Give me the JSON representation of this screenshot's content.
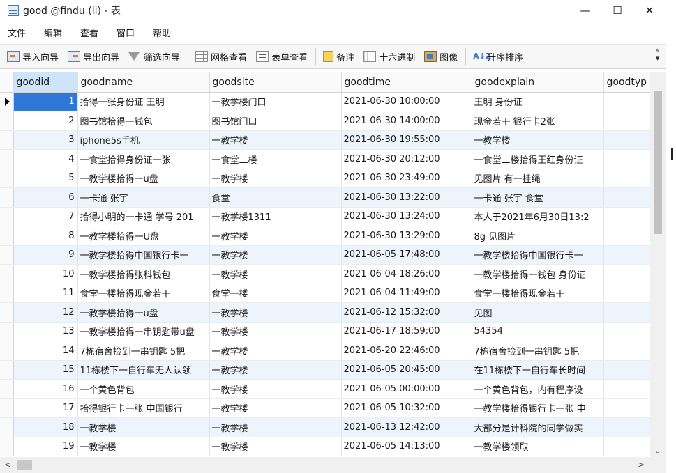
{
  "window": {
    "title": "good @findu (li) - 表",
    "minimize_glyph": "—",
    "maximize_glyph": "☐",
    "close_glyph": "✕"
  },
  "menu": [
    "文件",
    "编辑",
    "查看",
    "窗口",
    "帮助"
  ],
  "toolbar": {
    "import_label": "导入向导",
    "export_label": "导出向导",
    "filter_label": "筛选向导",
    "grid_view_label": "网格查看",
    "form_view_label": "表单查看",
    "note_label": "备注",
    "hex_label": "十六进制",
    "image_label": "图像",
    "sort_label": "升序排序",
    "sort_icon_text": "A↓Z",
    "more_glyph": "»"
  },
  "table": {
    "columns": [
      "goodid",
      "goodname",
      "goodsite",
      "goodtime",
      "goodexplain",
      "goodtyp"
    ],
    "rows": [
      [
        "1",
        "拾得一张身份证 王明",
        "一教学楼门口",
        "2021-06-30 10:00:00",
        "王明 身份证"
      ],
      [
        "2",
        "图书馆拾得一钱包",
        "图书馆门口",
        "2021-06-30 14:00:00",
        "现金若干 银行卡2张"
      ],
      [
        "3",
        "iphone5s手机",
        "一教学楼",
        "2021-06-30 19:55:00",
        "一教学楼"
      ],
      [
        "4",
        "一食堂拾得身份证一张",
        "一食堂二楼",
        "2021-06-30 20:12:00",
        "一食堂二楼拾得王红身份证"
      ],
      [
        "5",
        "一教学楼拾得一u盘",
        "一教学楼",
        "2021-06-30 23:49:00",
        "见图片 有一挂绳"
      ],
      [
        "6",
        "一卡通 张宇",
        "食堂",
        "2021-06-30 13:22:00",
        "一卡通 张宇 食堂"
      ],
      [
        "7",
        "拾得小明的一卡通 学号 201",
        "一教学楼1311",
        "2021-06-30 13:24:00",
        "本人于2021年6月30日13:2"
      ],
      [
        "8",
        "一教学楼拾得一U盘",
        "一教学楼",
        "2021-06-30 13:29:00",
        "8g 见图片"
      ],
      [
        "9",
        "一教学楼拾得中国银行卡一",
        "一教学楼",
        "2021-06-05 17:48:00",
        "一教学楼拾得中国银行卡一"
      ],
      [
        "10",
        "一教学楼拾得张科钱包",
        "一教学楼",
        "2021-06-04 18:26:00",
        "一教学楼拾得一钱包 身份证"
      ],
      [
        "11",
        "食堂一楼拾得现金若干",
        "食堂一楼",
        "2021-06-04 11:49:00",
        "食堂一楼拾得现金若干"
      ],
      [
        "12",
        "一教学楼拾得一u盘",
        "一教学楼",
        "2021-06-12 15:32:00",
        "见图"
      ],
      [
        "13",
        "一教学楼拾得一串钥匙带u盘",
        "一教学楼",
        "2021-06-17 18:59:00",
        "54354"
      ],
      [
        "14",
        "7栋宿舍捡到一串钥匙 5把",
        "一教学楼",
        "2021-06-20 22:46:00",
        "7栋宿舍捡到一串钥匙 5把"
      ],
      [
        "15",
        "11栋楼下一自行车无人认领",
        "一教学楼",
        "2021-06-05 20:45:00",
        "在11栋楼下一自行车长时间"
      ],
      [
        "16",
        "一个黄色背包",
        "一教学楼",
        "2021-06-05 00:00:00",
        "一个黄色背包，内有程序设"
      ],
      [
        "17",
        "拾得银行卡一张 中国银行",
        "一教学楼",
        "2021-06-05 10:32:00",
        "一教学楼拾得银行卡一张 中"
      ],
      [
        "18",
        "一教学楼",
        "一教学楼",
        "2021-06-13 12:42:00",
        "大部分是计科院的同学做实"
      ],
      [
        "19",
        "一教学楼",
        "一教学楼",
        "2021-06-05 14:13:00",
        "一教学楼领取"
      ]
    ]
  },
  "scrollbar": {
    "left_glyph": "<",
    "right_glyph": ">",
    "down_glyph": "⌄"
  }
}
